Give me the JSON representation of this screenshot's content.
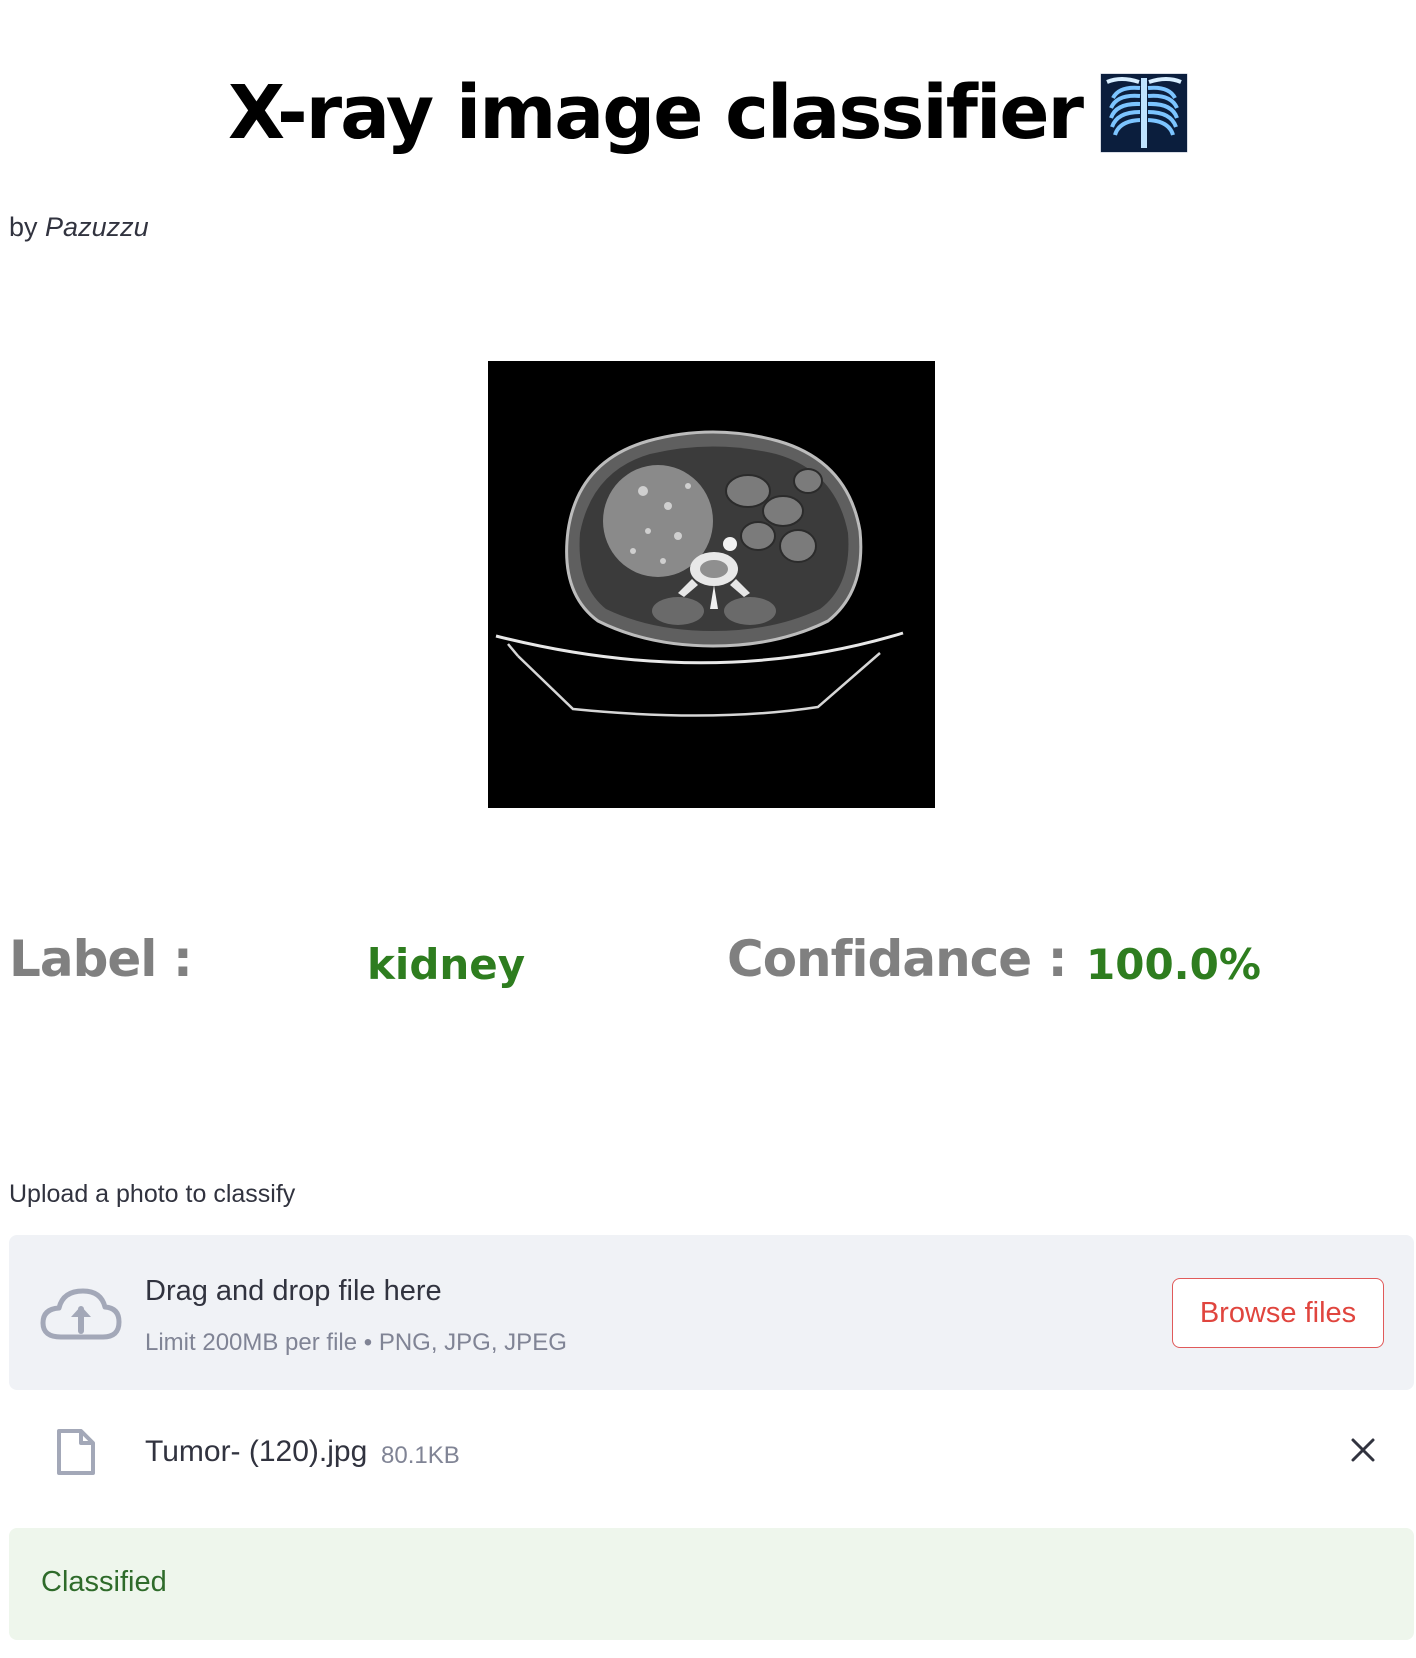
{
  "header": {
    "title": "X-ray image classifier",
    "emoji_icon": "x-ray-emoji"
  },
  "byline": {
    "prefix": "by",
    "author": "Pazuzzu"
  },
  "preview": {
    "image_icon": "ct-scan-image"
  },
  "result": {
    "label_key": "Label :",
    "label_value": "kidney",
    "confidence_key": "Confidance :",
    "confidence_value": "100.0%",
    "key_color": "#808080",
    "value_color": "#2e7d1f"
  },
  "uploader": {
    "label": "Upload a photo to classify",
    "drop_text": "Drag and drop file here",
    "limit_text": "Limit 200MB per file • PNG, JPG, JPEG",
    "browse_label": "Browse files",
    "icon": "cloud-upload-icon",
    "accent_color": "#e0453e"
  },
  "file": {
    "name": "Tumor- (120).jpg",
    "size": "80.1KB",
    "icon": "file-icon",
    "remove_icon": "close-icon"
  },
  "status": {
    "text": "Classified",
    "color": "#2e6b2a",
    "background": "#eef6ec"
  }
}
